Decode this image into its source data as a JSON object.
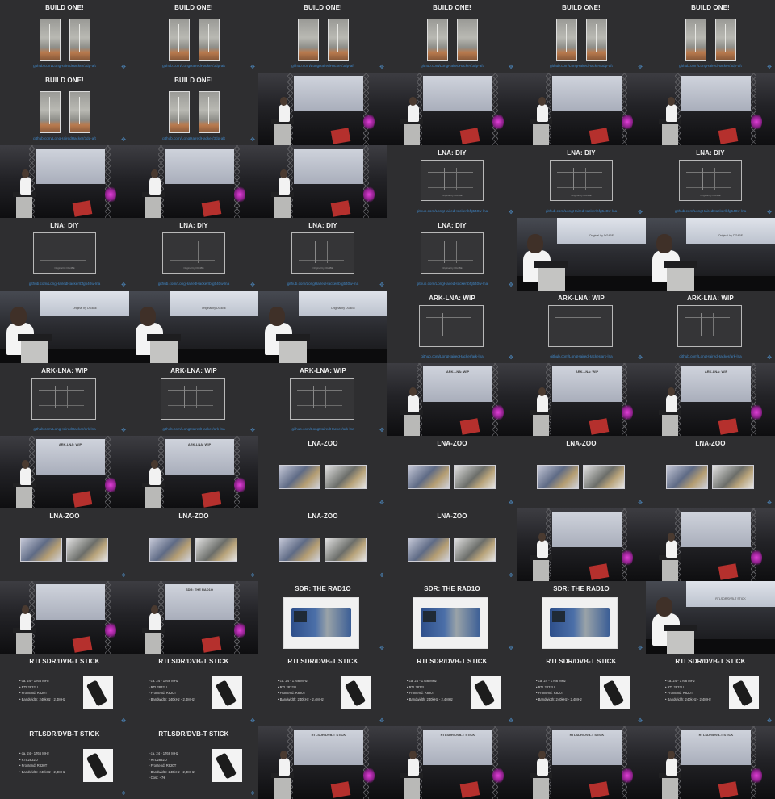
{
  "titles": {
    "build": "BUILD ONE!",
    "lna": "LNA: DIY",
    "ark": "ARK-LNA: WIP",
    "zoo": "LNA-ZOO",
    "rad": "SDR: THE RAD1O",
    "rtl": "RTLSDR/DVB-T STICK"
  },
  "links": {
    "build": "github.com/LongHairedHacker/3dp-aft",
    "lna": "github.com/LongHairedHacker/bfg540w-lna",
    "ark": "github.com/LongHairedHacker/ark-lna"
  },
  "captions": {
    "lna": "Original by DG4BE"
  },
  "screen_titles": {
    "ark": "ARK-LNA: WIP",
    "rad": "SDR: THE RAD1O",
    "rtl": "RTLSDR/DVB-T STICK"
  },
  "rtl_bullets": [
    "ca. 24 - 1766 MHz",
    "RTL2832U",
    "Frontend: R820T",
    "Bandwidth: 240kHz - 2,4MHz"
  ],
  "rtl_bullets_cost": [
    "ca. 24 - 1766 MHz",
    "RTL2832U",
    "Frontend: R820T",
    "Bandwidth: 240kHz - 2,4MHz",
    "Cost: ~7€"
  ],
  "icons": {
    "move": "move-arrows-icon"
  },
  "frames": [
    "build",
    "build",
    "build",
    "build",
    "build",
    "build",
    "build",
    "build",
    "stage-build",
    "stage-build",
    "stage-build",
    "stage-build",
    "stage-build",
    "stage-build",
    "stage-lna",
    "lna",
    "lna",
    "lna",
    "lna",
    "lna",
    "lna",
    "lna",
    "zoom-lna",
    "zoom-lna",
    "zoom-lna",
    "zoom-lna",
    "zoom-lna",
    "ark",
    "ark",
    "ark",
    "ark",
    "ark",
    "ark",
    "stage-ark",
    "stage-ark",
    "stage-ark",
    "stage-ark",
    "stage-ark",
    "zoo",
    "zoo",
    "zoo",
    "zoo",
    "zoo",
    "zoo",
    "zoo",
    "zoo",
    "stage-zoo",
    "stage-zoo",
    "stage-zoo",
    "stage-rad",
    "rad",
    "rad",
    "rad",
    "zoom-rtl",
    "rtl",
    "rtl",
    "rtl",
    "rtl",
    "rtl",
    "rtl",
    "rtl",
    "rtl-cost",
    "stage-rtl",
    "stage-rtl",
    "stage-rtl",
    "stage-rtl"
  ]
}
